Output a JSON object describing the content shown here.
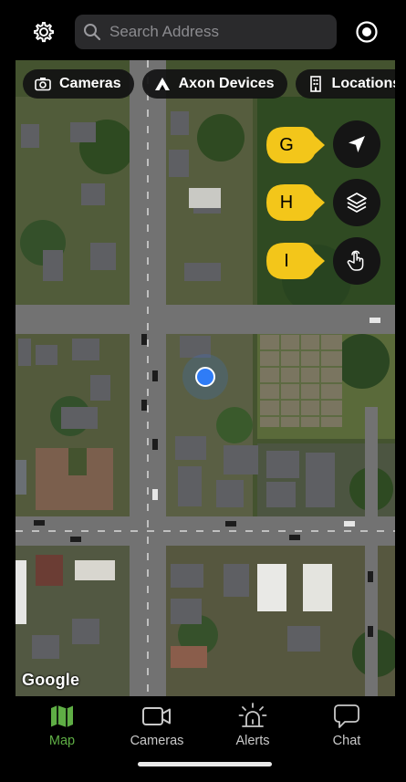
{
  "search": {
    "placeholder": "Search Address"
  },
  "icons": {
    "settings": "gear-icon",
    "search": "magnifier-icon",
    "recenter": "target-icon",
    "cameras_chip": "camera-icon",
    "axon_chip": "axon-logo-icon",
    "locations_chip": "building-icon",
    "locate": "location-arrow-icon",
    "layers": "layers-icon",
    "gesture": "hand-pointer-icon"
  },
  "filters": [
    {
      "label": "Cameras"
    },
    {
      "label": "Axon Devices"
    },
    {
      "label": "Locations"
    }
  ],
  "callouts": {
    "g": "G",
    "h": "H",
    "i": "I"
  },
  "map": {
    "attribution": "Google"
  },
  "tabs": [
    {
      "label": "Map",
      "active": true
    },
    {
      "label": "Cameras",
      "active": false
    },
    {
      "label": "Alerts",
      "active": false
    },
    {
      "label": "Chat",
      "active": false
    }
  ],
  "colors": {
    "accent": "#5fae45",
    "callout": "#f3c61a",
    "user_location": "#2f7cf6"
  }
}
